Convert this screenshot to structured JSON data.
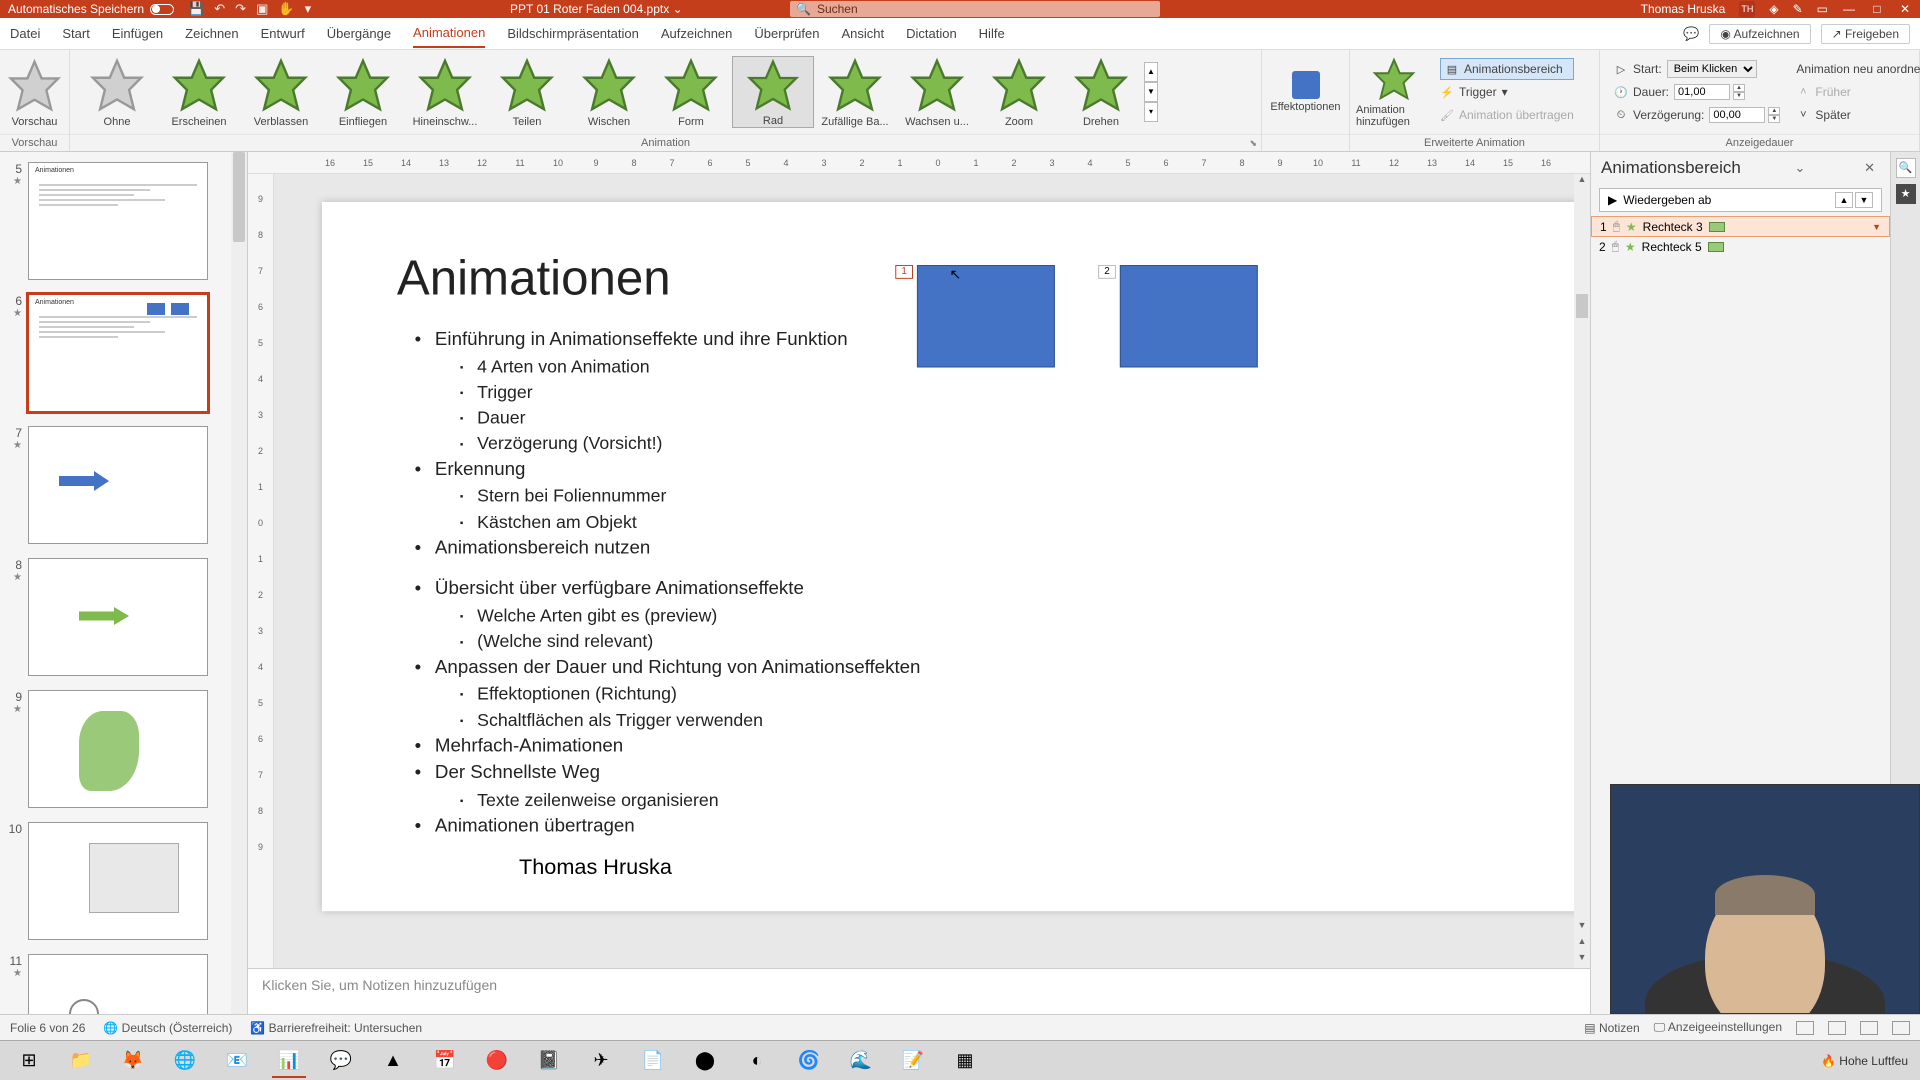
{
  "titlebar": {
    "autosave": "Automatisches Speichern",
    "filename": "PPT 01 Roter Faden 004.pptx",
    "search_placeholder": "Suchen",
    "user": "Thomas Hruska",
    "user_initials": "TH"
  },
  "tabs": [
    "Datei",
    "Start",
    "Einfügen",
    "Zeichnen",
    "Entwurf",
    "Übergänge",
    "Animationen",
    "Bildschirmpräsentation",
    "Aufzeichnen",
    "Überprüfen",
    "Ansicht",
    "Dictation",
    "Hilfe"
  ],
  "tabs_active": 6,
  "tab_right": {
    "record": "Aufzeichnen",
    "share": "Freigeben"
  },
  "ribbon": {
    "preview": "Vorschau",
    "anim_items": [
      "Ohne",
      "Erscheinen",
      "Verblassen",
      "Einfliegen",
      "Hineinschw...",
      "Teilen",
      "Wischen",
      "Form",
      "Rad",
      "Zufällige Ba...",
      "Wachsen u...",
      "Zoom",
      "Drehen"
    ],
    "anim_selected": 8,
    "group_anim": "Animation",
    "effectopts": "Effektoptionen",
    "add_anim": "Animation hinzufügen",
    "adv_group": "Erweiterte Animation",
    "adv": {
      "pane": "Animationsbereich",
      "trigger": "Trigger",
      "painter": "Animation übertragen"
    },
    "timing_group": "Anzeigedauer",
    "timing": {
      "start_label": "Start:",
      "start_value": "Beim Klicken",
      "dur_label": "Dauer:",
      "dur_value": "01,00",
      "delay_label": "Verzögerung:",
      "delay_value": "00,00",
      "reorder": "Animation neu anordnen",
      "earlier": "Früher",
      "later": "Später"
    }
  },
  "thumbs": [
    {
      "n": "5",
      "star": true,
      "title": "Animationen"
    },
    {
      "n": "6",
      "star": true,
      "title": "Animationen",
      "active": true
    },
    {
      "n": "7",
      "star": true
    },
    {
      "n": "8",
      "star": true
    },
    {
      "n": "9",
      "star": true
    },
    {
      "n": "10",
      "star": false
    },
    {
      "n": "11",
      "star": true
    }
  ],
  "slide": {
    "title": "Animationen",
    "bullets": [
      {
        "t": "Einführung in Animationseffekte und ihre Funktion",
        "sub": [
          "4 Arten von Animation",
          "Trigger",
          "Dauer",
          "Verzögerung (Vorsicht!)"
        ]
      },
      {
        "t": "Erkennung",
        "sub": [
          "Stern bei Foliennummer",
          "Kästchen am Objekt"
        ]
      },
      {
        "t": "Animationsbereich nutzen",
        "sub": [],
        "gap": true
      },
      {
        "t": "Übersicht über verfügbare Animationseffekte",
        "sub": [
          "Welche Arten gibt es (preview)",
          "(Welche sind relevant)"
        ]
      },
      {
        "t": "Anpassen der Dauer und Richtung von Animationseffekten",
        "sub": [
          "Effektoptionen (Richtung)",
          "Schaltflächen als Trigger verwenden"
        ]
      },
      {
        "t": "Mehrfach-Animationen",
        "sub": []
      },
      {
        "t": "Der Schnellste Weg",
        "sub": [
          "Texte zeilenweise organisieren"
        ]
      },
      {
        "t": "Animationen übertragen",
        "sub": []
      }
    ],
    "author": "Thomas Hruska",
    "tags": [
      "1",
      "2"
    ]
  },
  "notes_placeholder": "Klicken Sie, um Notizen hinzuzufügen",
  "animpane": {
    "title": "Animationsbereich",
    "play": "Wiedergeben ab",
    "items": [
      {
        "n": "1",
        "name": "Rechteck 3",
        "sel": true
      },
      {
        "n": "2",
        "name": "Rechteck 5",
        "sel": false
      }
    ]
  },
  "status": {
    "slide": "Folie 6 von 26",
    "lang": "Deutsch (Österreich)",
    "access": "Barrierefreiheit: Untersuchen",
    "notes": "Notizen",
    "display": "Anzeigeeinstellungen"
  },
  "taskbar": {
    "weather": "Hohe Luftfeu"
  },
  "ruler_h": [
    "16",
    "15",
    "14",
    "13",
    "12",
    "11",
    "10",
    "9",
    "8",
    "7",
    "6",
    "5",
    "4",
    "3",
    "2",
    "1",
    "0",
    "1",
    "2",
    "3",
    "4",
    "5",
    "6",
    "7",
    "8",
    "9",
    "10",
    "11",
    "12",
    "13",
    "14",
    "15",
    "16"
  ],
  "ruler_v": [
    "9",
    "8",
    "7",
    "6",
    "5",
    "4",
    "3",
    "2",
    "1",
    "0",
    "1",
    "2",
    "3",
    "4",
    "5",
    "6",
    "7",
    "8",
    "9"
  ]
}
